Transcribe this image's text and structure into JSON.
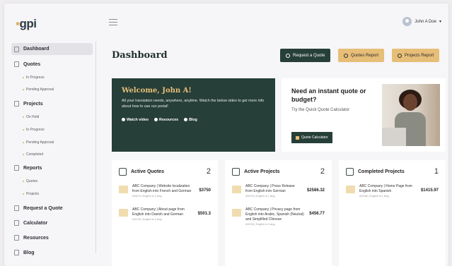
{
  "header": {
    "logo_prefix": "•",
    "logo_text": "gpi",
    "user_name": "John A Doe",
    "user_caret": "▾"
  },
  "sidebar": {
    "dashboard": "Dashboard",
    "quotes": "Quotes",
    "quotes_in_progress": "In Progress",
    "quotes_pending": "Pending Approval",
    "projects": "Projects",
    "projects_on_hold": "On Hold",
    "projects_in_progress": "In Progress",
    "projects_pending": "Pending Approval",
    "projects_completed": "Completed",
    "reports": "Reports",
    "reports_quotes": "Quotes",
    "reports_projects": "Projects",
    "request_quote": "Request a Quote",
    "calculator": "Calculator",
    "resources": "Resources",
    "blog": "Blog"
  },
  "main": {
    "title": "Dashboard",
    "btn_request": "Request a Quote",
    "btn_quotes_report": "Quotes Report",
    "btn_projects_report": "Projects Report"
  },
  "welcome": {
    "heading": "Welcome, John A!",
    "body": "All your translation needs, anywhere, anytime. Watch the below video to get more info about how to use our portal!",
    "link_video": "Watch video",
    "link_resources": "Resources",
    "link_blog": "Blog"
  },
  "quote_calc": {
    "heading": "Need an instant quote or budget?",
    "body": "Try the Quick Quote Calculator",
    "button": "Quote Calculator"
  },
  "active_quotes": {
    "title": "Active Quotes",
    "count": "2",
    "rows": [
      {
        "desc": "ABC Company | Website localization from English into French and German",
        "meta": "#20074 | English to 2 lang",
        "amount": "$3750"
      },
      {
        "desc": "ABC Company | About page from English into Danish and German",
        "meta": "#20795 | English to 2 lang",
        "amount": "$501.3"
      }
    ]
  },
  "active_projects": {
    "title": "Active Projects",
    "count": "2",
    "rows": [
      {
        "desc": "ABC Company | Press Release from English into German",
        "meta": "#20478 | English to 1 lang",
        "amount": "$2586.32"
      },
      {
        "desc": "ABC Company | Privacy page from English into Arabic, Spanish (Neutral) and Simplified Chinese",
        "meta": "#20236 | English to 3 lang",
        "amount": "$456.77"
      }
    ]
  },
  "completed_projects": {
    "title": "Completed Projects",
    "count": "1",
    "rows": [
      {
        "desc": "ABC Company | Home Page from English into Spanish",
        "meta": "#20185 | English to 1 lang",
        "amount": "$1415.97"
      }
    ]
  },
  "colors": {
    "brand_dark": "#263f38",
    "brand_gold": "#e7be78",
    "background": "#f6f5f7"
  }
}
